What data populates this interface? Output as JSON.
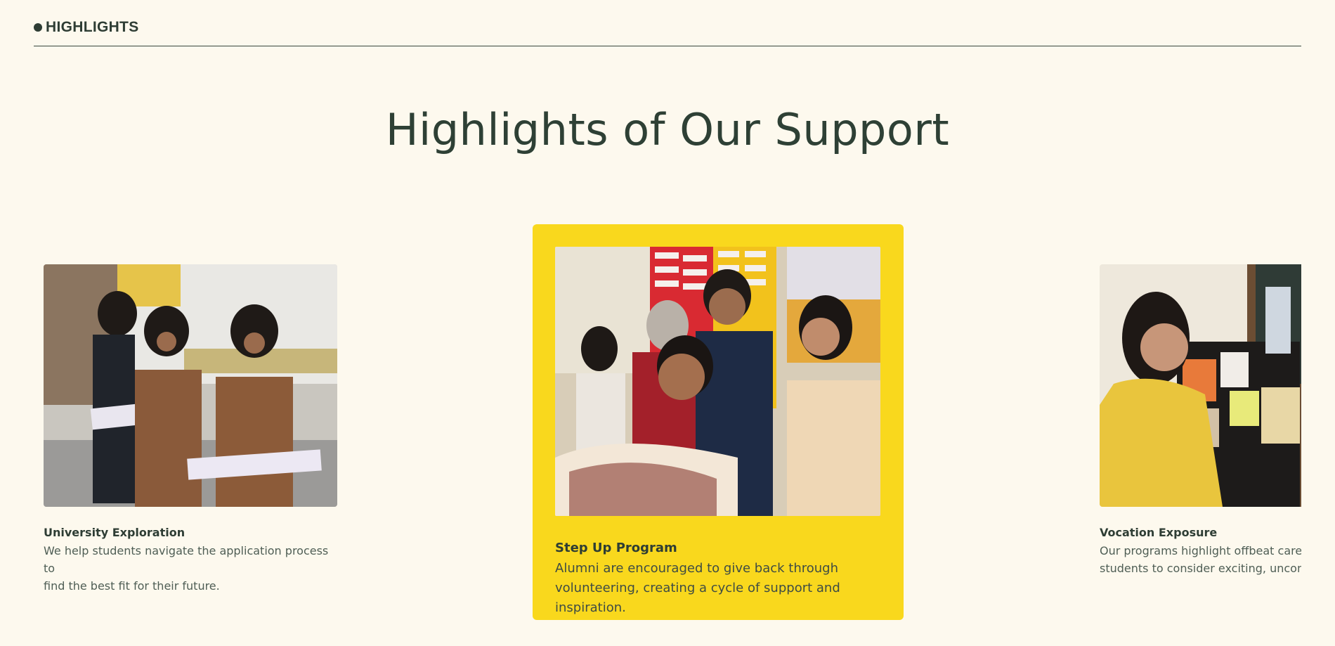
{
  "section": {
    "tag": "HIGHLIGHTS"
  },
  "heading": {
    "title": "Highlights of Our Support"
  },
  "cards": [
    {
      "title": "University Exploration",
      "description_line1": "We help students navigate the application process to",
      "description_line2": "find the best fit for their future.",
      "image": "students-reading-photo",
      "active": false
    },
    {
      "title": "Step Up Program",
      "description_line1": "Alumni are encouraged to give back through",
      "description_line2": "volunteering, creating a cycle of support and inspiration.",
      "image": "group-selfie-photo",
      "active": true
    },
    {
      "title": "Vocation Exposure",
      "description_line1": "Our programs highlight offbeat careers",
      "description_line2": "students to consider exciting, unconver",
      "image": "mentor-classroom-photo",
      "active": false
    }
  ],
  "colors": {
    "background": "#fdf9ee",
    "text": "#2e3d34",
    "active_card": "#f9d81d"
  }
}
